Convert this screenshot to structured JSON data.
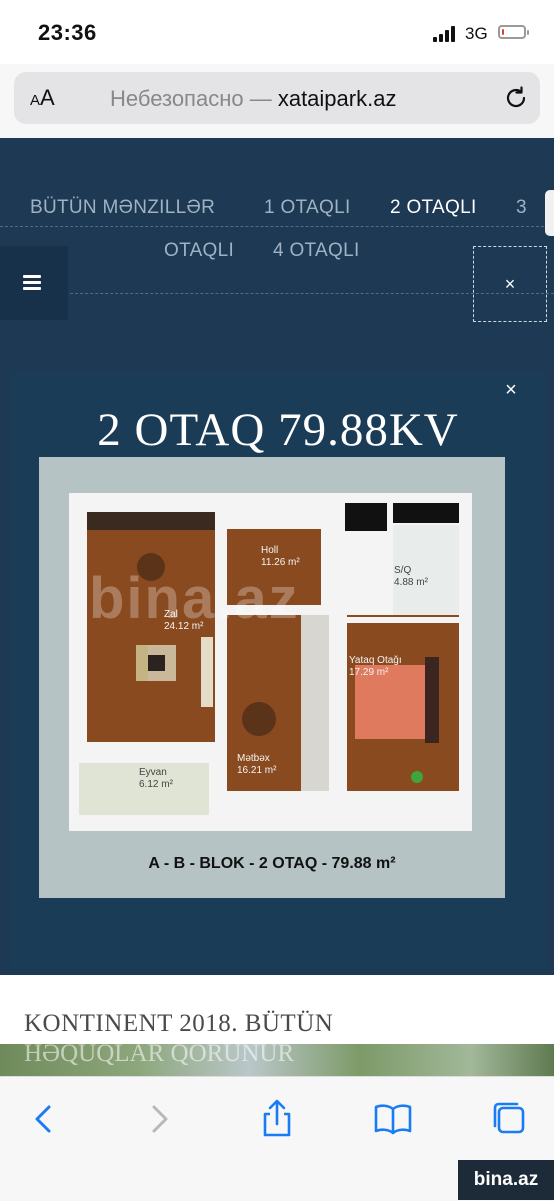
{
  "status_bar": {
    "time": "23:36",
    "network": "3G",
    "battery_level": 0.1,
    "battery_color": "#e33c3c"
  },
  "browser": {
    "text_size_button": "AA",
    "url_prefix": "Небезопасно — ",
    "url_domain": "xataipark.az",
    "reload_icon": "reload-icon"
  },
  "nav": {
    "items": [
      {
        "label": "BÜTÜN MƏNZILLƏR",
        "active": false
      },
      {
        "label": "1 OTAQLI",
        "active": false
      },
      {
        "label": "2 OTAQLI",
        "active": true
      },
      {
        "label": "3",
        "active": false
      },
      {
        "label": "OTAQLI",
        "active": false
      },
      {
        "label": "4 OTAQLI",
        "active": false
      }
    ],
    "menu_icon": "hamburger-menu-icon",
    "close_symbol": "×"
  },
  "modal": {
    "close_symbol": "×",
    "title": "2 OTAQ 79.88KV",
    "plan": {
      "watermark": "bina.az",
      "rooms": [
        {
          "name": "Zal",
          "area": "24.12 m²"
        },
        {
          "name": "Holl",
          "area": "11.26 m²"
        },
        {
          "name": "S/Q",
          "area": "4.88 m²"
        },
        {
          "name": "Yataq Otağı",
          "area": "17.29 m²"
        },
        {
          "name": "Mətbəx",
          "area": "16.21 m²"
        },
        {
          "name": "Eyvan",
          "area": "6.12 m²"
        }
      ],
      "caption": "A - B - BLOK - 2 OTAQ - 79.88 m²"
    }
  },
  "article": {
    "title": "KONTINENT 2018. BÜTÜN",
    "title_line2": "HƏQUQLAR QORUNUR"
  },
  "toolbar": {
    "buttons": [
      "back-icon",
      "forward-icon",
      "share-icon",
      "bookmarks-icon",
      "tabs-icon"
    ]
  },
  "site_watermark": "bina.az",
  "colors": {
    "page_bg": "#1d3954",
    "modal_bg": "#1b3c57",
    "accent_ios": "#1a7cf5",
    "floor_wood": "#8a4a1f"
  }
}
